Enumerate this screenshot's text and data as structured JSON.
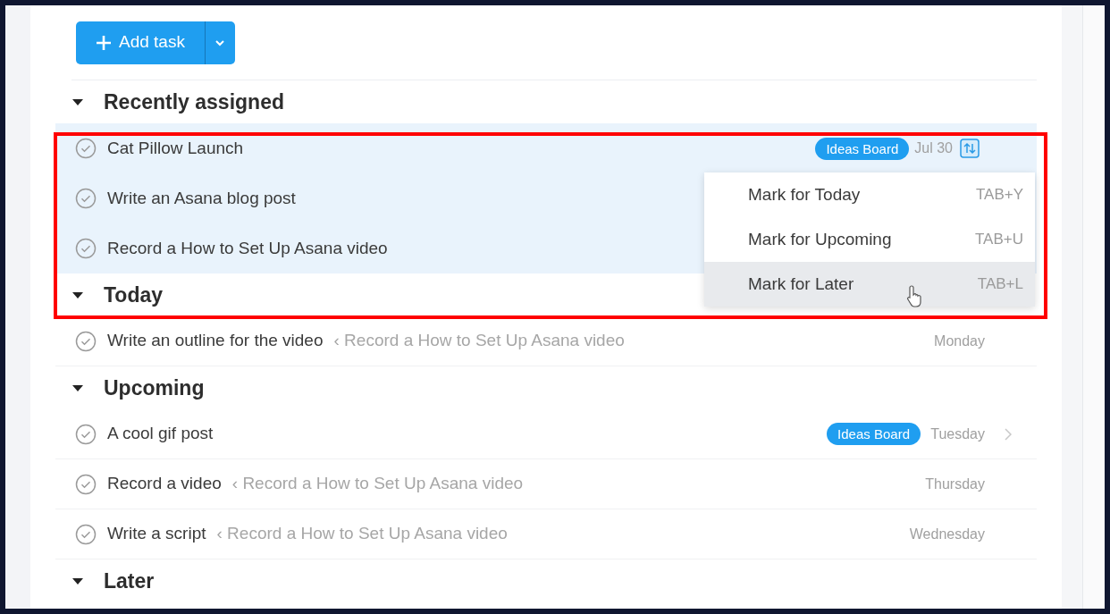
{
  "add_task": {
    "label": "Add task"
  },
  "sections": [
    {
      "title": "Recently assigned",
      "expanded": true,
      "tasks": [
        {
          "name": "Cat Pillow Launch",
          "selected": true,
          "tag": "Ideas Board",
          "due": "Jul 30",
          "menu_open": true
        },
        {
          "name": "Write an Asana blog post",
          "selected": true
        },
        {
          "name": "Record a How to Set Up Asana video",
          "selected": true
        }
      ]
    },
    {
      "title": "Today",
      "expanded": true,
      "tasks": [
        {
          "name": "Write an outline for the video",
          "parent": "‹ Record a How to Set Up Asana video",
          "due": "Monday",
          "selected": false
        }
      ]
    },
    {
      "title": "Upcoming",
      "expanded": true,
      "tasks": [
        {
          "name": "A cool gif post",
          "tag": "Ideas Board",
          "due": "Tuesday",
          "selected": false,
          "hovered": true
        },
        {
          "name": "Record a video",
          "parent": "‹ Record a How to Set Up Asana video",
          "due": "Thursday",
          "selected": false
        },
        {
          "name": "Write a script",
          "parent": "‹ Record a How to Set Up Asana video",
          "due": "Wednesday",
          "selected": false
        }
      ]
    },
    {
      "title": "Later",
      "expanded": true
    }
  ],
  "mark_menu": {
    "items": [
      {
        "label": "Mark for Today",
        "shortcut": "TAB+Y",
        "selected": false
      },
      {
        "label": "Mark for Upcoming",
        "shortcut": "TAB+U",
        "selected": false
      },
      {
        "label": "Mark for Later",
        "shortcut": "TAB+L",
        "selected": true
      }
    ]
  }
}
